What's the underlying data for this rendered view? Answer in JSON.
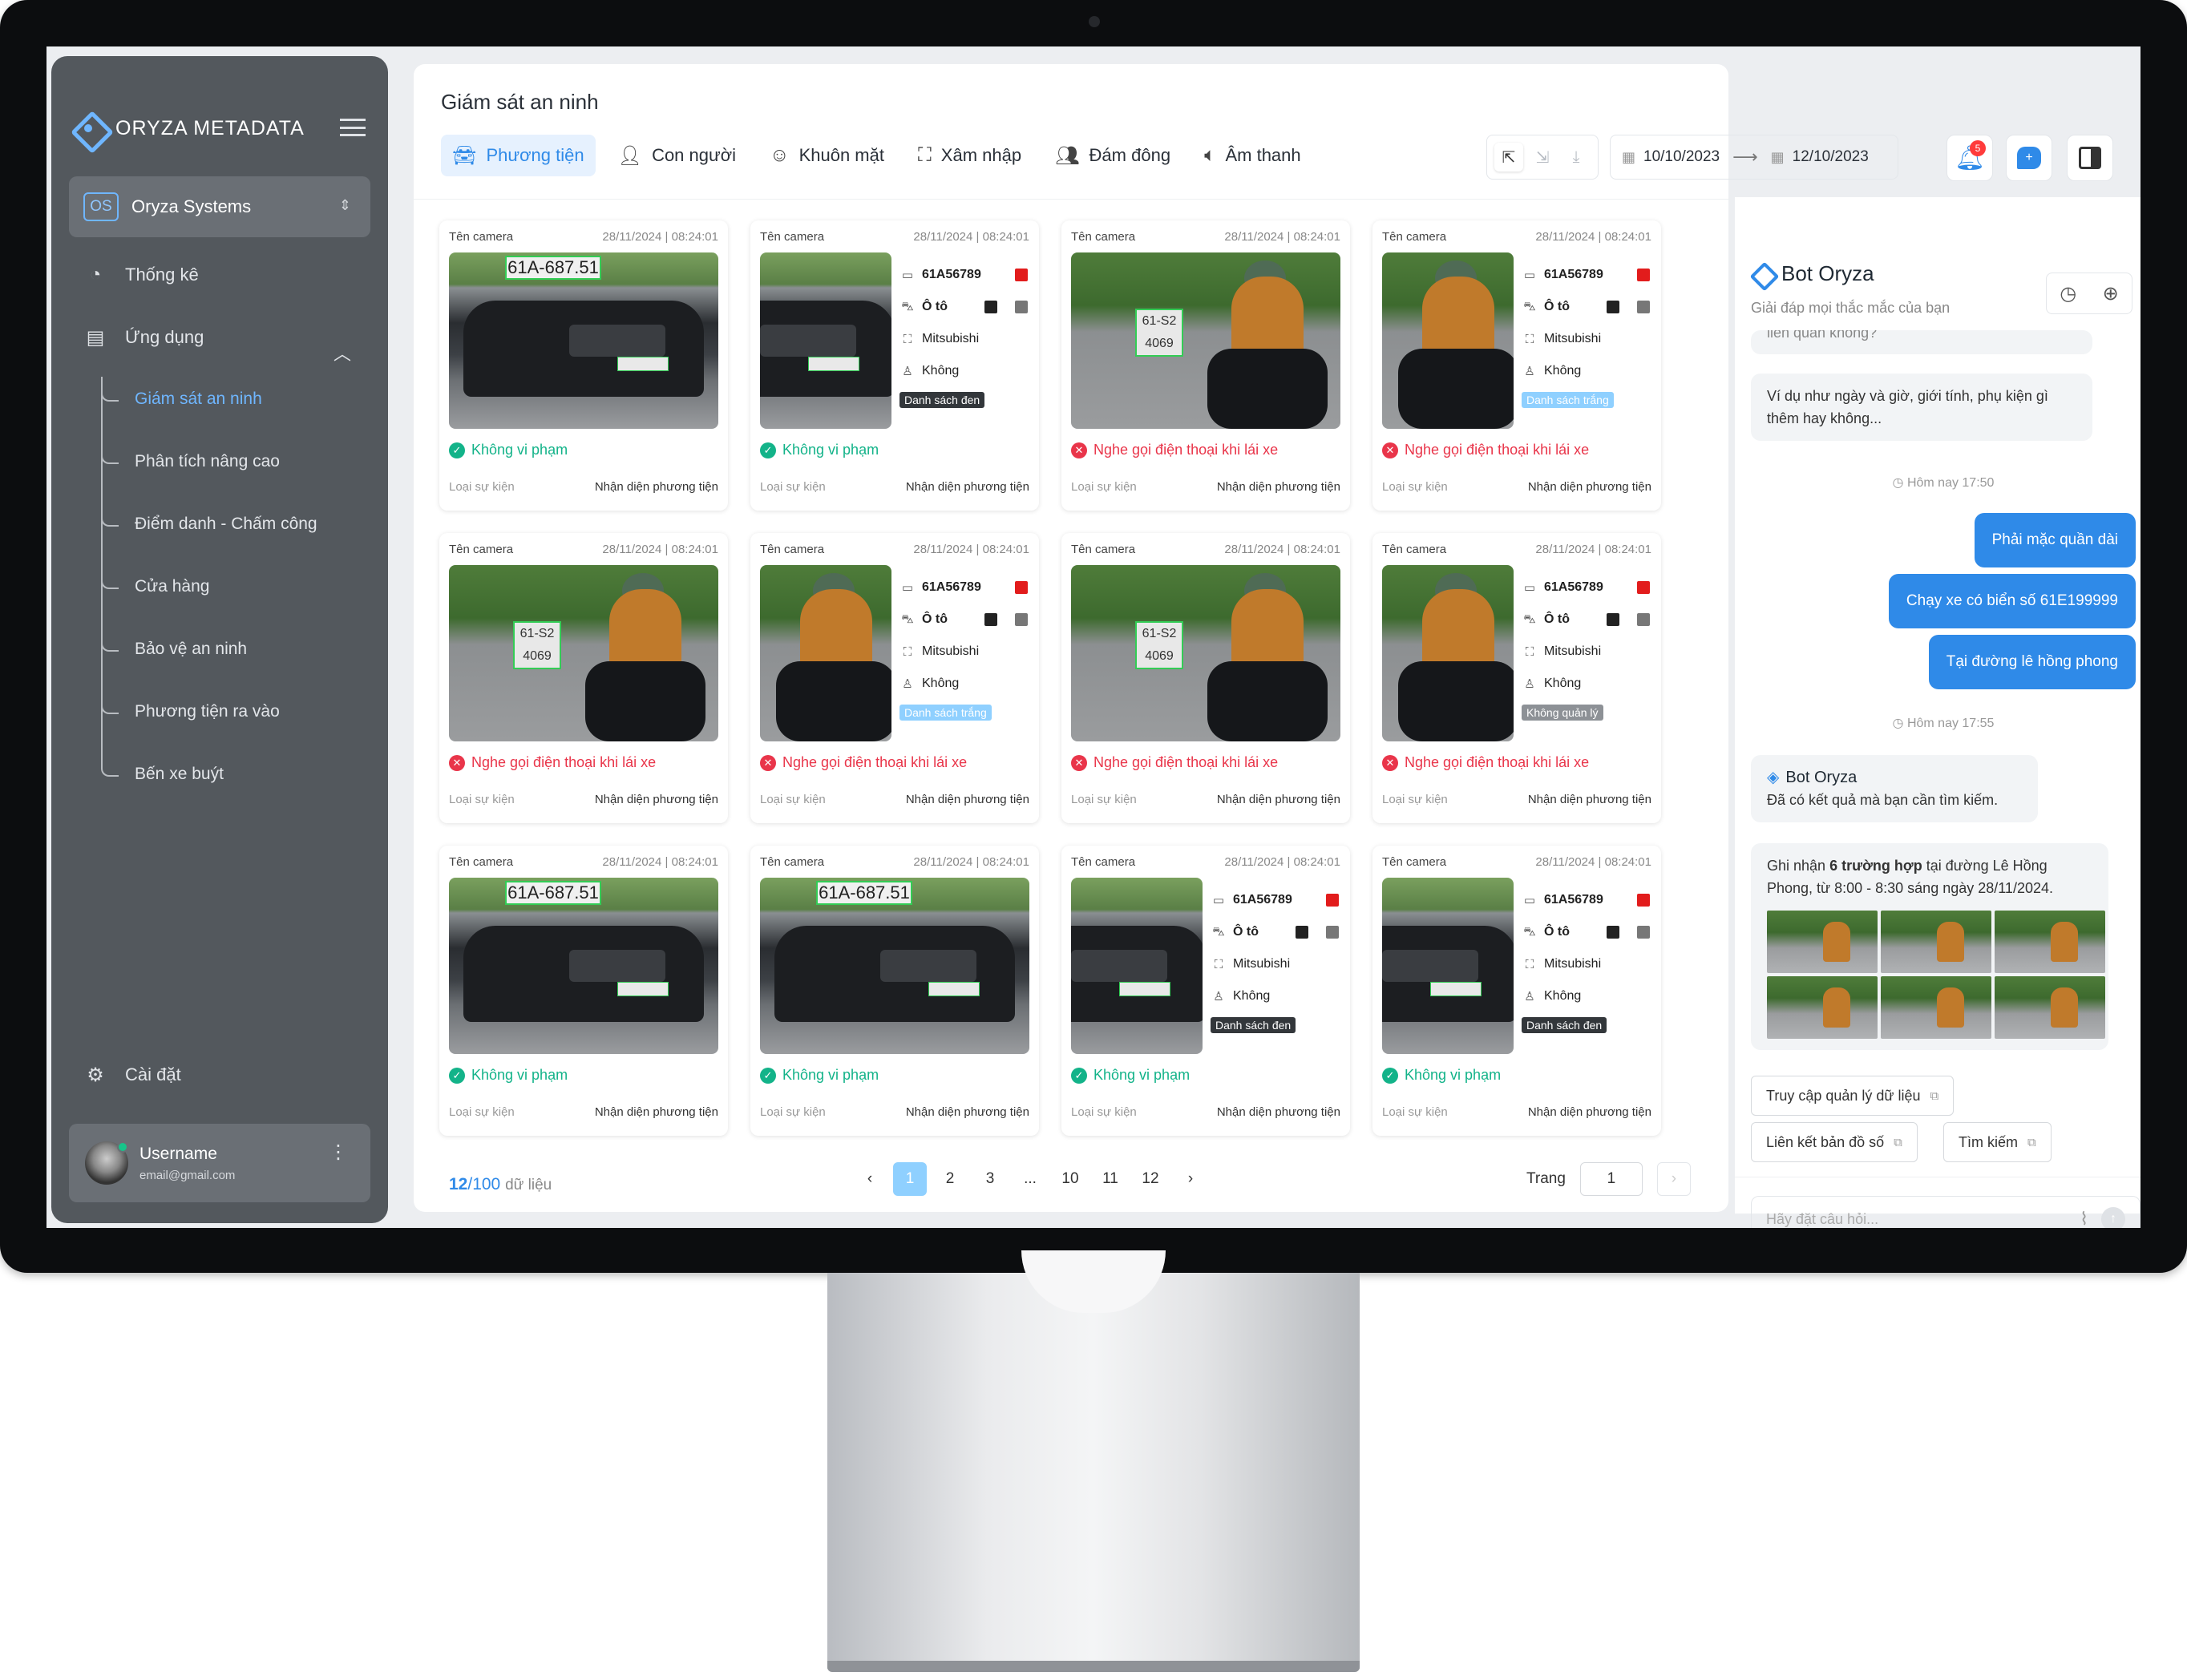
{
  "sidebar": {
    "brand": "ORYZA METADATA",
    "org_badge": "OS",
    "org_name": "Oryza Systems",
    "nav": {
      "stats": "Thống kê",
      "apps": "Ứng dụng",
      "settings": "Cài đặt"
    },
    "sub_items": [
      "Giám sát an ninh",
      "Phân tích nâng cao",
      "Điểm danh - Chấm công",
      "Cửa hàng",
      "Bảo vệ an ninh",
      "Phương tiện ra vào",
      "Bến xe buýt"
    ],
    "user": {
      "name": "Username",
      "email": "email@gmail.com"
    }
  },
  "header": {
    "title": "Giám sát an ninh",
    "tabs": [
      "Phương tiện",
      "Con người",
      "Khuôn mặt",
      "Xâm nhập",
      "Đám đông",
      "Âm thanh"
    ],
    "date_from": "10/10/2023",
    "date_to": "12/10/2023",
    "notification_count": "5"
  },
  "cards": [
    {
      "camera": "Tên camera",
      "time": "28/11/2024 | 08:24:01",
      "kind": "car",
      "full": true,
      "plate": "61A-687.51",
      "status": "ok",
      "status_text": "Không vi phạm",
      "type_label": "Loại sự kiện",
      "type_value": "Nhận diện phương tiện"
    },
    {
      "camera": "Tên camera",
      "time": "28/11/2024 | 08:24:01",
      "kind": "car",
      "full": false,
      "plate_id": "61A56789",
      "vtype": "Ô tô",
      "brand": "Mitsubishi",
      "extra": "Không",
      "tag": "Danh sách đen",
      "tag_style": "dark",
      "c1": "#e21c1c",
      "c2": "#222222",
      "c3": "#777777",
      "status": "ok",
      "status_text": "Không vi phạm",
      "type_label": "Loại sự kiện",
      "type_value": "Nhận diện phương tiện"
    },
    {
      "camera": "Tên camera",
      "time": "28/11/2024 | 08:24:01",
      "kind": "moto",
      "full": true,
      "plate": "61-S2 4069",
      "status": "bad",
      "status_text": "Nghe gọi điện thoại khi lái xe",
      "type_label": "Loại sự kiện",
      "type_value": "Nhận diện phương tiện"
    },
    {
      "camera": "Tên camera",
      "time": "28/11/2024 | 08:24:01",
      "kind": "moto",
      "full": false,
      "plate_id": "61A56789",
      "vtype": "Ô tô",
      "brand": "Mitsubishi",
      "extra": "Không",
      "tag": "Danh sách trắng",
      "tag_style": "light",
      "c1": "#e21c1c",
      "c2": "#222222",
      "c3": "#777777",
      "status": "bad",
      "status_text": "Nghe gọi điện thoại khi lái xe",
      "type_label": "Loại sự kiện",
      "type_value": "Nhận diện phương tiện"
    },
    {
      "camera": "Tên camera",
      "time": "28/11/2024 | 08:24:01",
      "kind": "moto",
      "full": true,
      "plate": "61-S2 4069",
      "status": "bad",
      "status_text": "Nghe gọi điện thoại khi lái xe",
      "type_label": "Loại sự kiện",
      "type_value": "Nhận diện phương tiện"
    },
    {
      "camera": "Tên camera",
      "time": "28/11/2024 | 08:24:01",
      "kind": "moto",
      "full": false,
      "plate_id": "61A56789",
      "vtype": "Ô tô",
      "brand": "Mitsubishi",
      "extra": "Không",
      "tag": "Danh sách trắng",
      "tag_style": "light",
      "c1": "#e21c1c",
      "c2": "#222222",
      "c3": "#777777",
      "status": "bad",
      "status_text": "Nghe gọi điện thoại khi lái xe",
      "type_label": "Loại sự kiện",
      "type_value": "Nhận diện phương tiện"
    },
    {
      "camera": "Tên camera",
      "time": "28/11/2024 | 08:24:01",
      "kind": "moto",
      "full": true,
      "plate": "61-S2 4069",
      "status": "bad",
      "status_text": "Nghe gọi điện thoại khi lái xe",
      "type_label": "Loại sự kiện",
      "type_value": "Nhận diện phương tiện"
    },
    {
      "camera": "Tên camera",
      "time": "28/11/2024 | 08:24:01",
      "kind": "moto",
      "full": false,
      "plate_id": "61A56789",
      "vtype": "Ô tô",
      "brand": "Mitsubishi",
      "extra": "Không",
      "tag": "Không quản lý",
      "tag_style": "gray",
      "c1": "#e21c1c",
      "c2": "#222222",
      "c3": "#777777",
      "status": "bad",
      "status_text": "Nghe gọi điện thoại khi lái xe",
      "type_label": "Loại sự kiện",
      "type_value": "Nhận diện phương tiện"
    },
    {
      "camera": "Tên camera",
      "time": "28/11/2024 | 08:24:01",
      "kind": "car",
      "full": true,
      "plate": "61A-687.51",
      "status": "ok",
      "status_text": "Không vi phạm",
      "type_label": "Loại sự kiện",
      "type_value": "Nhận diện phương tiện"
    },
    {
      "camera": "Tên camera",
      "time": "28/11/2024 | 08:24:01",
      "kind": "car",
      "full": true,
      "plate": "61A-687.51",
      "status": "ok",
      "status_text": "Không vi phạm",
      "type_label": "Loại sự kiện",
      "type_value": "Nhận diện phương tiện"
    },
    {
      "camera": "Tên camera",
      "time": "28/11/2024 | 08:24:01",
      "kind": "car",
      "full": false,
      "plate_id": "61A56789",
      "vtype": "Ô tô",
      "brand": "Mitsubishi",
      "extra": "Không",
      "tag": "Danh sách đen",
      "tag_style": "dark",
      "c1": "#e21c1c",
      "c2": "#222222",
      "c3": "#777777",
      "status": "ok",
      "status_text": "Không vi phạm",
      "type_label": "Loại sự kiện",
      "type_value": "Nhận diện phương tiện"
    },
    {
      "camera": "Tên camera",
      "time": "28/11/2024 | 08:24:01",
      "kind": "car",
      "full": false,
      "plate_id": "61A56789",
      "vtype": "Ô tô",
      "brand": "Mitsubishi",
      "extra": "Không",
      "tag": "Danh sách đen",
      "tag_style": "dark",
      "c1": "#e21c1c",
      "c2": "#222222",
      "c3": "#777777",
      "status": "ok",
      "status_text": "Không vi phạm",
      "type_label": "Loại sự kiện",
      "type_value": "Nhận diện phương tiện"
    }
  ],
  "pagination": {
    "shown": "12",
    "total": "/100",
    "suffix": "dữ liệu",
    "pages": [
      "1",
      "2",
      "3",
      "...",
      "10",
      "11",
      "12"
    ],
    "goto_label": "Trang",
    "goto_value": "1"
  },
  "chat": {
    "title": "Bot Oryza",
    "subtitle": "Giải đáp mọi thắc mắc của bạn",
    "clipped": "liên quan không?",
    "msg1": "Ví dụ như ngày và giờ, giới tính, phụ kiện gì thêm hay không...",
    "time1": "Hôm nay 17:50",
    "out1": "Phải mặc quần dài",
    "out2": "Chạy xe có biển số 61E199999",
    "out3": "Tại đường lê hồng phong",
    "time2": "Hôm nay 17:55",
    "bot_name": "Bot Oryza",
    "bot_msg": "Đã có kết quả mà bạn cần tìm kiếm.",
    "result_pre": "Ghi nhận ",
    "result_bold": "6 trường hợp",
    "result_post": " tại đường Lê Hồng Phong, từ 8:00 - 8:30 sáng ngày 28/11/2024.",
    "link1": "Truy cập quản lý dữ liệu",
    "link2": "Liên kết bản đồ số",
    "link3": "Tìm kiếm",
    "input_placeholder": "Hãy đặt câu hỏi..."
  }
}
